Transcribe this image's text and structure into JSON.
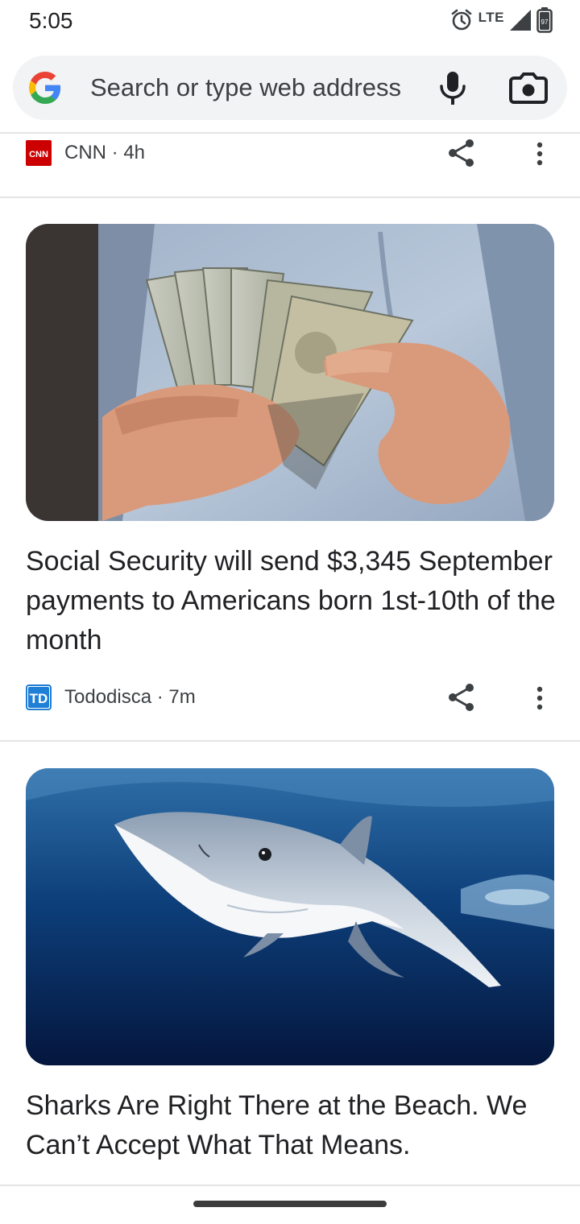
{
  "status_bar": {
    "time": "5:05",
    "network": "LTE",
    "battery_level": "97"
  },
  "omnibox": {
    "placeholder": "Search or type web address"
  },
  "feed": {
    "top_item": {
      "source": "CNN",
      "age": "4h",
      "logo_text": "CNN"
    },
    "cards": [
      {
        "image_name": "man-counting-dollar-bills",
        "headline": "Social Security will send $3,345 September payments to Americans born 1st-10th of the month",
        "source": "Tododisca",
        "age": "7m",
        "logo_text": "TD"
      },
      {
        "image_name": "blue-shark-underwater",
        "headline": "Sharks Are Right There at the Beach. We Can’t Accept What That Means."
      }
    ]
  },
  "icons": {
    "alarm": "alarm-icon",
    "signal": "signal-icon",
    "battery": "battery-icon",
    "google": "google-logo",
    "mic": "mic-icon",
    "camera": "camera-icon",
    "share": "share-icon",
    "more": "more-vert-icon"
  },
  "colors": {
    "google_blue": "#4285F4",
    "google_red": "#EA4335",
    "google_yellow": "#FBBC05",
    "google_green": "#34A853",
    "cnn_red": "#cc0000",
    "td_blue": "#1f7fd6"
  }
}
